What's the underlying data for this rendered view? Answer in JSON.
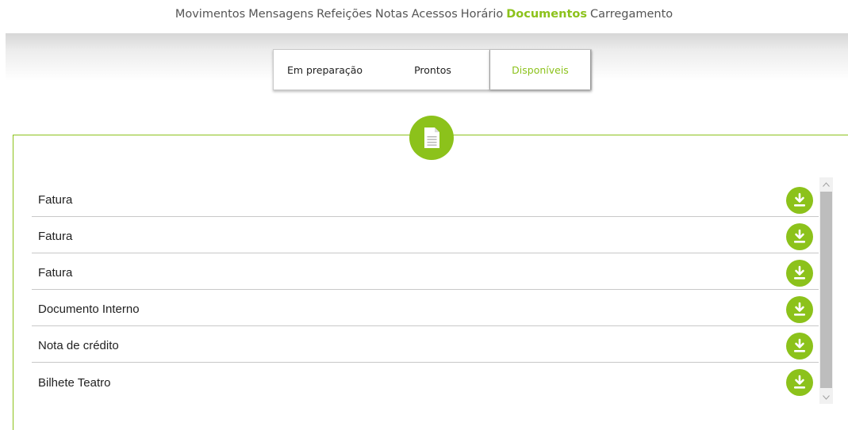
{
  "nav": {
    "items": [
      "Movimentos",
      "Mensagens",
      "Refeições",
      "Notas",
      "Acessos",
      "Horário",
      "Documentos",
      "Carregamento"
    ],
    "active": "Documentos"
  },
  "tabs": {
    "items": [
      "Em preparação",
      "Prontos",
      "Disponíveis"
    ],
    "active": "Disponíveis"
  },
  "documents": [
    {
      "label": "Fatura",
      "icon": "download-icon"
    },
    {
      "label": "Fatura",
      "icon": "download-icon"
    },
    {
      "label": "Fatura",
      "icon": "download-icon"
    },
    {
      "label": "Documento Interno",
      "icon": "download-icon"
    },
    {
      "label": "Nota de crédito",
      "icon": "download-icon"
    },
    {
      "label": "Bilhete Teatro",
      "icon": "download-icon"
    }
  ],
  "section_icon": "document-icon",
  "colors": {
    "accent": "#8cc21b",
    "text": "#222222",
    "nav_text": "#555555"
  }
}
